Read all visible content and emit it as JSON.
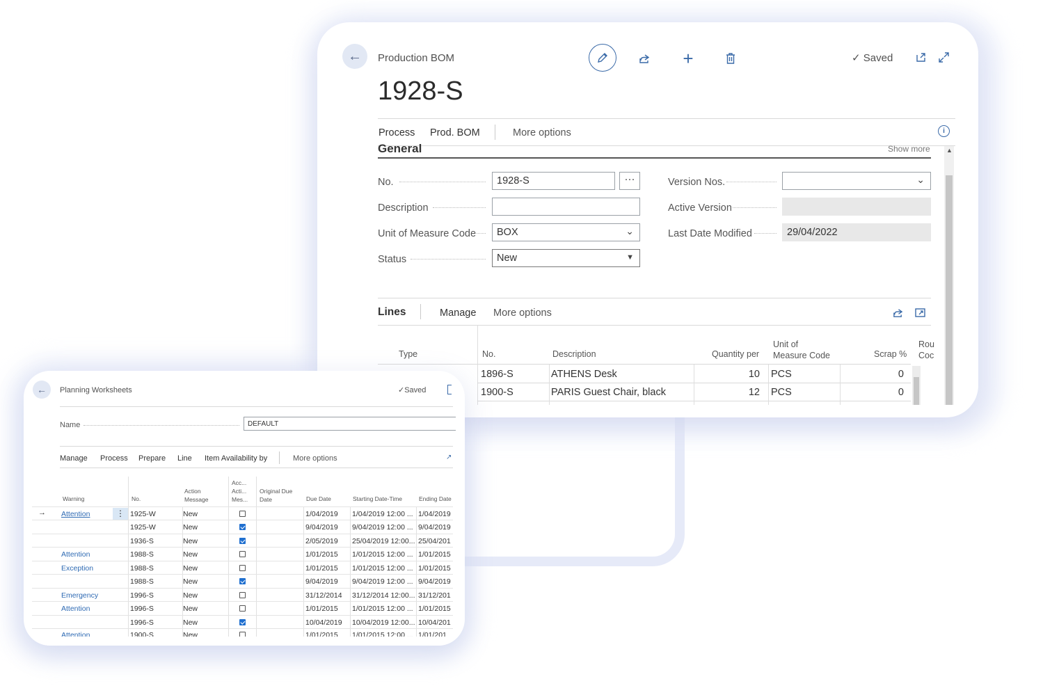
{
  "bom": {
    "caption": "Production BOM",
    "title": "1928-S",
    "saved": "Saved",
    "actions": {
      "process": "Process",
      "prod_bom": "Prod. BOM",
      "more": "More options"
    },
    "section_title": "General",
    "show_more": "Show more",
    "fields": {
      "no_label": "No.",
      "no_value": "1928-S",
      "ellipsis": "···",
      "description_label": "Description",
      "description_value": "",
      "uom_label": "Unit of Measure Code",
      "uom_value": "BOX",
      "status_label": "Status",
      "status_value": "New",
      "version_label": "Version Nos.",
      "version_value": "",
      "active_version_label": "Active Version",
      "active_version_value": "",
      "last_modified_label": "Last Date Modified",
      "last_modified_value": "29/04/2022"
    },
    "lines": {
      "title": "Lines",
      "manage": "Manage",
      "more": "More options",
      "headers": {
        "type": "Type",
        "no": "No.",
        "description": "Description",
        "qty": "Quantity per",
        "uom_1": "Unit of",
        "uom_2": "Measure Code",
        "scrap": "Scrap %",
        "rou_1": "Rou",
        "rou_2": "Coc"
      },
      "rows": [
        {
          "no": "1896-S",
          "description": "ATHENS Desk",
          "qty": "10",
          "uom": "PCS",
          "scrap": "0"
        },
        {
          "no": "1900-S",
          "description": "PARIS Guest Chair, black",
          "qty": "12",
          "uom": "PCS",
          "scrap": "0"
        }
      ]
    }
  },
  "pw": {
    "caption": "Planning Worksheets",
    "saved": "Saved",
    "name_label": "Name",
    "name_value": "DEFAULT",
    "actions": {
      "manage": "Manage",
      "process": "Process",
      "prepare": "Prepare",
      "line": "Line",
      "item_avail": "Item Availability by",
      "more": "More options"
    },
    "headers": {
      "warning": "Warning",
      "no": "No.",
      "action_1": "Action",
      "action_2": "Message",
      "acc_1": "Acc...",
      "acc_2": "Acti...",
      "acc_3": "Mes...",
      "orig_1": "Original Due",
      "orig_2": "Date",
      "due": "Due Date",
      "start": "Starting Date-Time",
      "end": "Ending Date"
    },
    "row_arrow": "→",
    "row_menu": "⋮",
    "rows": [
      {
        "warning": "Attention",
        "no": "1925-W",
        "action": "New",
        "checked": false,
        "due": "1/04/2019",
        "start": "1/04/2019 12:00 ...",
        "end": "1/04/2019"
      },
      {
        "warning": "",
        "no": "1925-W",
        "action": "New",
        "checked": true,
        "due": "9/04/2019",
        "start": "9/04/2019 12:00 ...",
        "end": "9/04/2019"
      },
      {
        "warning": "",
        "no": "1936-S",
        "action": "New",
        "checked": true,
        "due": "2/05/2019",
        "start": "25/04/2019 12:00...",
        "end": "25/04/201"
      },
      {
        "warning": "Attention",
        "no": "1988-S",
        "action": "New",
        "checked": false,
        "due": "1/01/2015",
        "start": "1/01/2015 12:00 ...",
        "end": "1/01/2015"
      },
      {
        "warning": "Exception",
        "no": "1988-S",
        "action": "New",
        "checked": false,
        "due": "1/01/2015",
        "start": "1/01/2015 12:00 ...",
        "end": "1/01/2015"
      },
      {
        "warning": "",
        "no": "1988-S",
        "action": "New",
        "checked": true,
        "due": "9/04/2019",
        "start": "9/04/2019 12:00 ...",
        "end": "9/04/2019"
      },
      {
        "warning": "Emergency",
        "no": "1996-S",
        "action": "New",
        "checked": false,
        "due": "31/12/2014",
        "start": "31/12/2014 12:00...",
        "end": "31/12/201"
      },
      {
        "warning": "Attention",
        "no": "1996-S",
        "action": "New",
        "checked": false,
        "due": "1/01/2015",
        "start": "1/01/2015 12:00 ...",
        "end": "1/01/2015"
      },
      {
        "warning": "",
        "no": "1996-S",
        "action": "New",
        "checked": true,
        "due": "10/04/2019",
        "start": "10/04/2019 12:00...",
        "end": "10/04/201"
      },
      {
        "warning": "Attention",
        "no": "1900-S",
        "action": "New",
        "checked": false,
        "due": "1/01/2015",
        "start": "1/01/2015 12:00 ...",
        "end": "1/01/201"
      }
    ]
  },
  "colors": {
    "accent": "#3a6aa8",
    "link": "#2e6ab3",
    "checkbox": "#1f6fcf"
  }
}
